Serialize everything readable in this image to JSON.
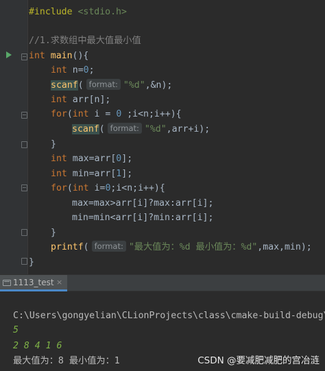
{
  "editor": {
    "include_directive": "#include",
    "include_header": "<stdio.h>",
    "comment": "//1.求数组中最大值最小值",
    "main_type": "int",
    "main_name": "main",
    "main_paren": "(){",
    "line_n_type": "int",
    "line_n_rest": " n=",
    "line_n_num": "0",
    "line_n_end": ";",
    "scanf1_name": "scanf",
    "scanf1_open": "(",
    "hint_format": "format:",
    "scanf1_str": "\"%d\"",
    "scanf1_rest": ",&n);",
    "arr_type": "int",
    "arr_rest": " arr[n];",
    "for1_kw": "for",
    "for1_open": "(",
    "for1_type": "int",
    "for1_var": " i = ",
    "for1_num": "0",
    "for1_rest": " ;i<n;i++){",
    "scanf2_name": "scanf",
    "scanf2_open": "(",
    "scanf2_str": "\"%d\"",
    "scanf2_rest": ",arr+i);",
    "close_brace": "}",
    "max_type": "int",
    "max_rest": " max=arr[",
    "max_num": "0",
    "max_end": "];",
    "min_type": "int",
    "min_rest": " min=arr[",
    "min_num": "1",
    "min_end": "];",
    "for2_kw": "for",
    "for2_open": "(",
    "for2_type": "int",
    "for2_var": " i=",
    "for2_num": "0",
    "for2_rest": ";i<n;i++){",
    "max_line": "max=max>arr[i]?max:arr[i];",
    "min_line": "min=min<arr[i]?min:arr[i];",
    "printf_name": "printf",
    "printf_open": "(",
    "printf_str": "\"最大值为：%d 最小值为：%d\"",
    "printf_rest": ",max,min);",
    "main_close": "}"
  },
  "run_window": {
    "tab_label": "1113_test",
    "tab_close": "×",
    "path_line": "C:\\Users\\gongyelian\\CLionProjects\\class\\cmake-build-debug\\",
    "input_1": "5",
    "input_2": "2 8 4 1 6",
    "output": "最大值为：8 最小值为：1"
  },
  "watermark": "CSDN @要减肥减肥的宫冶涟"
}
